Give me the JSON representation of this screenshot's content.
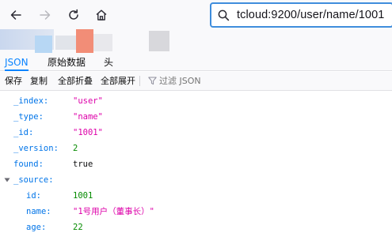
{
  "browser": {
    "url": "tcloud:9200/user/name/1001",
    "icons": [
      "back-icon",
      "forward-icon",
      "reload-icon",
      "home-icon",
      "search-icon"
    ]
  },
  "bookmarks": {
    "blur_colors": [
      "#c7d6ec",
      "#dfe3ea",
      "#b5d6f3",
      "#f08c77",
      "#e4e4e8",
      "#d6d6da"
    ]
  },
  "viewer": {
    "tabs": [
      {
        "label": "JSON",
        "selected": true
      },
      {
        "label": "原始数据",
        "selected": false
      },
      {
        "label": "头",
        "selected": false
      }
    ],
    "toolbar": {
      "save": "保存",
      "copy": "复制",
      "collapse_all": "全部折叠",
      "expand_all": "全部展开",
      "filter_placeholder": "过滤 JSON"
    }
  },
  "json": {
    "rows": [
      {
        "key": "_index:",
        "value": "\"user\"",
        "type": "string"
      },
      {
        "key": "_type:",
        "value": "\"name\"",
        "type": "string"
      },
      {
        "key": "_id:",
        "value": "\"1001\"",
        "type": "string"
      },
      {
        "key": "_version:",
        "value": "2",
        "type": "number"
      },
      {
        "key": "found:",
        "value": "true",
        "type": "bool"
      },
      {
        "key": "_source:",
        "value": "",
        "type": "object"
      }
    ],
    "source_rows": [
      {
        "key": "id:",
        "value": "1001",
        "type": "number"
      },
      {
        "key": "name:",
        "value": "\"1号用户（董事长）\"",
        "type": "string"
      },
      {
        "key": "age:",
        "value": "22",
        "type": "number"
      }
    ]
  },
  "colors": {
    "accent": "#0a84ff",
    "url_border": "#3f8ddc",
    "json_key": "#0074e8",
    "json_string": "#dd00a9",
    "json_number": "#058b00"
  }
}
